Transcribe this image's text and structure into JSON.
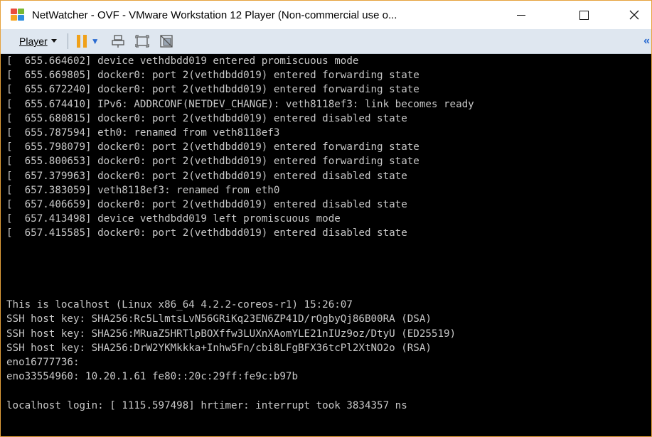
{
  "window": {
    "title": "NetWatcher - OVF - VMware Workstation 12 Player (Non-commercial use o...",
    "accent": "#e6a23c"
  },
  "toolbar": {
    "player_label": "Player",
    "icons": [
      "pause-icon",
      "send-ctrl-alt-del-icon",
      "full-screen-icon",
      "unity-icon",
      "collapse-toolbar-icon"
    ],
    "pause_color": "#f0a11a"
  },
  "console": {
    "kernel_lines": [
      "[  655.664602] device vethdbdd019 entered promiscuous mode",
      "[  655.669805] docker0: port 2(vethdbdd019) entered forwarding state",
      "[  655.672240] docker0: port 2(vethdbdd019) entered forwarding state",
      "[  655.674410] IPv6: ADDRCONF(NETDEV_CHANGE): veth8118ef3: link becomes ready",
      "[  655.680815] docker0: port 2(vethdbdd019) entered disabled state",
      "[  655.787594] eth0: renamed from veth8118ef3",
      "[  655.798079] docker0: port 2(vethdbdd019) entered forwarding state",
      "[  655.800653] docker0: port 2(vethdbdd019) entered forwarding state",
      "[  657.379963] docker0: port 2(vethdbdd019) entered disabled state",
      "[  657.383059] veth8118ef3: renamed from eth0",
      "[  657.406659] docker0: port 2(vethdbdd019) entered disabled state",
      "[  657.413498] device vethdbdd019 left promiscuous mode",
      "[  657.415585] docker0: port 2(vethdbdd019) entered disabled state"
    ],
    "info_lines": [
      "This is localhost (Linux x86_64 4.2.2-coreos-r1) 15:26:07",
      "SSH host key: SHA256:Rc5LlmtsLvN56GRiKq23EN6ZP41D/rOgbyQj86B00RA (DSA)",
      "SSH host key: SHA256:MRuaZ5HRTlpBOXffw3LUXnXAomYLE21nIUz9oz/DtyU (ED25519)",
      "SSH host key: SHA256:DrW2YKMkkka+Inhw5Fn/cbi8LFgBFX36tcPl2XtNO2o (RSA)",
      "eno16777736:",
      "eno33554960: 10.20.1.61 fe80::20c:29ff:fe9c:b97b"
    ],
    "login_line": "localhost login: [ 1115.597498] hrtimer: interrupt took 3834357 ns"
  }
}
